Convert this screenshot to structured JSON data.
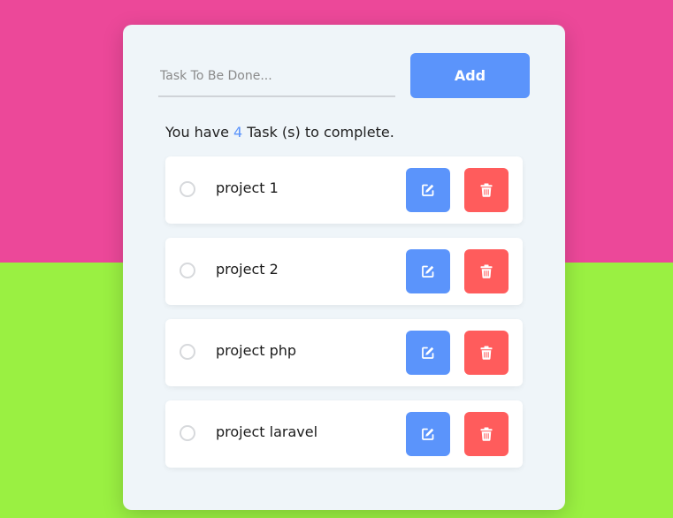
{
  "colors": {
    "background_top": "#ec4899",
    "background_bottom": "#9af042",
    "accent": "#5b94fb",
    "danger": "#ff5c5c"
  },
  "form": {
    "input_placeholder": "Task To Be Done...",
    "input_value": "",
    "add_label": "Add"
  },
  "summary": {
    "prefix": "You have ",
    "count": "4",
    "suffix": " Task (s) to complete."
  },
  "tasks": [
    {
      "label": "project 1",
      "completed": false,
      "edit_icon": "edit-icon",
      "delete_icon": "trash-icon"
    },
    {
      "label": "project 2",
      "completed": false,
      "edit_icon": "edit-icon",
      "delete_icon": "trash-icon"
    },
    {
      "label": "project php",
      "completed": false,
      "edit_icon": "edit-icon",
      "delete_icon": "trash-icon"
    },
    {
      "label": "project laravel",
      "completed": false,
      "edit_icon": "edit-icon",
      "delete_icon": "trash-icon"
    }
  ]
}
